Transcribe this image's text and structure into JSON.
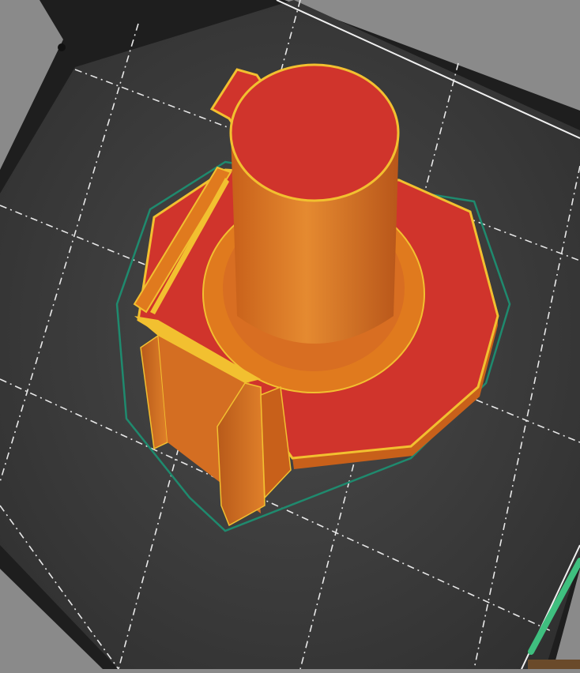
{
  "scene": {
    "view": "slicer-preview-3d",
    "colors": {
      "background": "#8a8a8a",
      "bed": "#3a3a3a",
      "grid": "#e8e8e8",
      "skirt": "#1f8a6e",
      "top_solid_infill": "#d0342c",
      "perimeter": "#e07a1e",
      "outer_perimeter": "#f2c030",
      "wipe_tower": "#3fbf7f"
    }
  }
}
